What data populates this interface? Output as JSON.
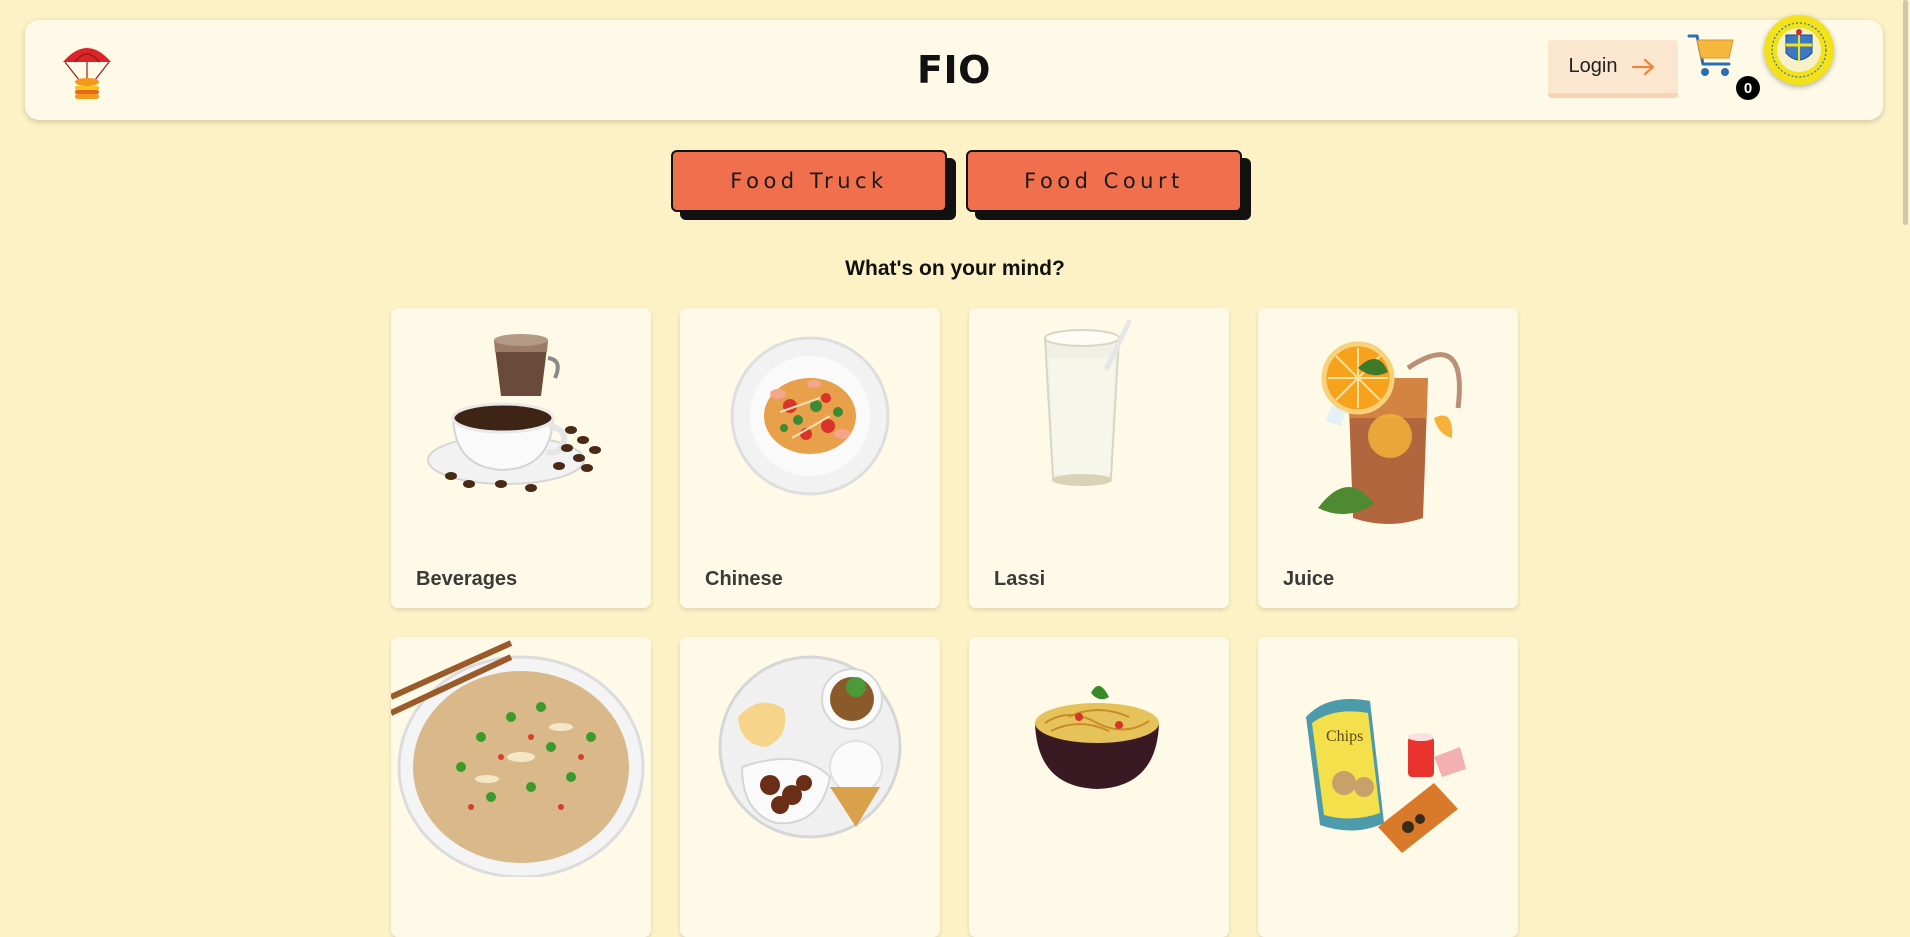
{
  "header": {
    "logo_icon": "parachute-burger-icon",
    "title": "FIO",
    "login_label": "Login",
    "cart_count": "0",
    "avatar_icon": "institute-seal-icon"
  },
  "modes": [
    {
      "label": "Food Truck"
    },
    {
      "label": "Food Court"
    }
  ],
  "section_heading": "What's on your mind?",
  "categories": [
    {
      "label": "Beverages",
      "icon": "coffee-cups-icon"
    },
    {
      "label": "Chinese",
      "icon": "noodle-salad-plate-icon"
    },
    {
      "label": "Lassi",
      "icon": "lassi-glass-icon"
    },
    {
      "label": "Juice",
      "icon": "iced-tea-glass-icon"
    },
    {
      "label": "",
      "icon": "fried-rice-icon"
    },
    {
      "label": "",
      "icon": "thali-plate-icon"
    },
    {
      "label": "",
      "icon": "noodle-bowl-icon"
    },
    {
      "label": "",
      "icon": "chips-snacks-icon"
    }
  ],
  "colors": {
    "page_background": "#fdf1c6",
    "card_background": "#fffae8",
    "mode_button": "#f0704e",
    "login_button": "#fbe7cf"
  }
}
